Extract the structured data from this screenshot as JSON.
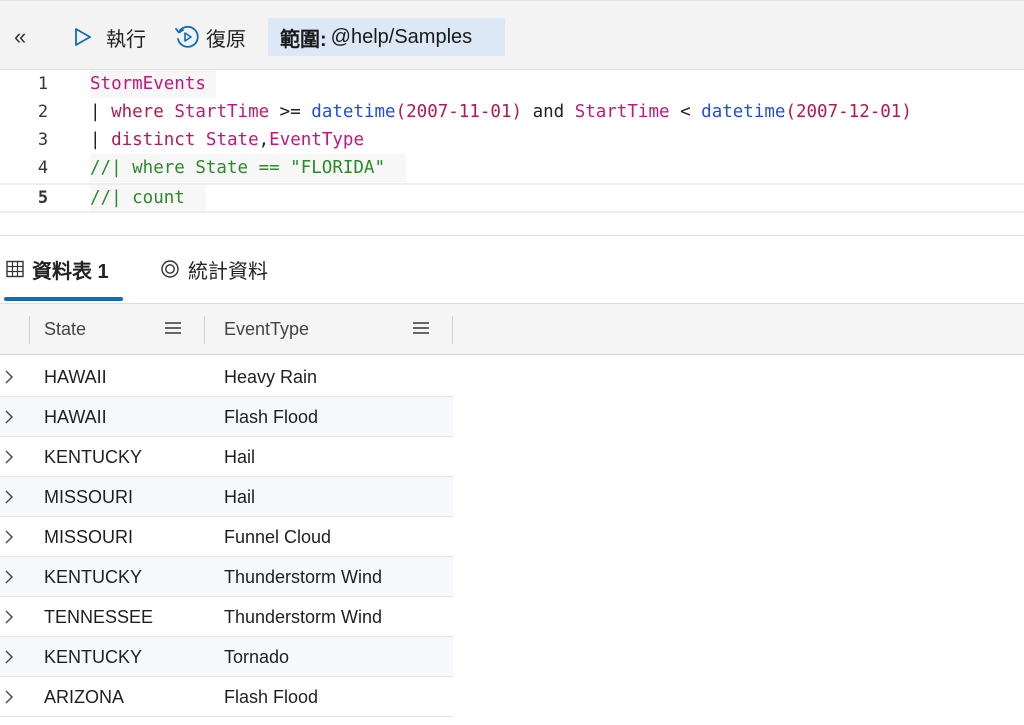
{
  "toolbar": {
    "collapse_glyph": "«",
    "run_label": "執行",
    "restore_label": "復原",
    "scope_label": "範圍:",
    "scope_value": "@help/Samples"
  },
  "editor": {
    "lines": [
      {
        "number": "1"
      },
      {
        "number": "2"
      },
      {
        "number": "3"
      },
      {
        "number": "4"
      },
      {
        "number": "5"
      }
    ],
    "tokens": {
      "l1_table": "StormEvents",
      "l2_pipe": "| ",
      "l2_where": "where",
      "l2_col1": "StartTime",
      "l2_ge": " >= ",
      "l2_func1": "datetime",
      "l2_arg1": "(2007-11-01)",
      "l2_and": " and ",
      "l2_col2": "StartTime",
      "l2_lt": " < ",
      "l2_func2": "datetime",
      "l2_arg2": "(2007-12-01)",
      "l3_pipe": "| ",
      "l3_distinct": "distinct",
      "l3_cols": "State",
      "l3_comma": ",",
      "l3_cols2": "EventType",
      "l4_comment": "//| where State == \"FLORIDA\"",
      "l5_comment": "//| count"
    }
  },
  "tabs": {
    "table_label": "資料表 1",
    "stats_label": "統計資料"
  },
  "grid": {
    "columns": [
      "State",
      "EventType"
    ],
    "rows": [
      {
        "state": "HAWAII",
        "event": "Heavy Rain"
      },
      {
        "state": "HAWAII",
        "event": "Flash Flood"
      },
      {
        "state": "KENTUCKY",
        "event": "Hail"
      },
      {
        "state": "MISSOURI",
        "event": "Hail"
      },
      {
        "state": "MISSOURI",
        "event": "Funnel Cloud"
      },
      {
        "state": "KENTUCKY",
        "event": "Thunderstorm Wind"
      },
      {
        "state": "TENNESSEE",
        "event": "Thunderstorm Wind"
      },
      {
        "state": "KENTUCKY",
        "event": "Tornado"
      },
      {
        "state": "ARIZONA",
        "event": "Flash Flood"
      }
    ]
  },
  "colors": {
    "accent": "#0f6cbd",
    "scope_bg": "#dce8f5",
    "keyword": "#c0187a",
    "function": "#1f4fd6",
    "comment": "#2a8a2a"
  },
  "icons": [
    "collapse-icon",
    "run-icon",
    "restore-icon",
    "table-icon",
    "stats-icon",
    "column-menu-icon",
    "chevron-right-icon"
  ]
}
